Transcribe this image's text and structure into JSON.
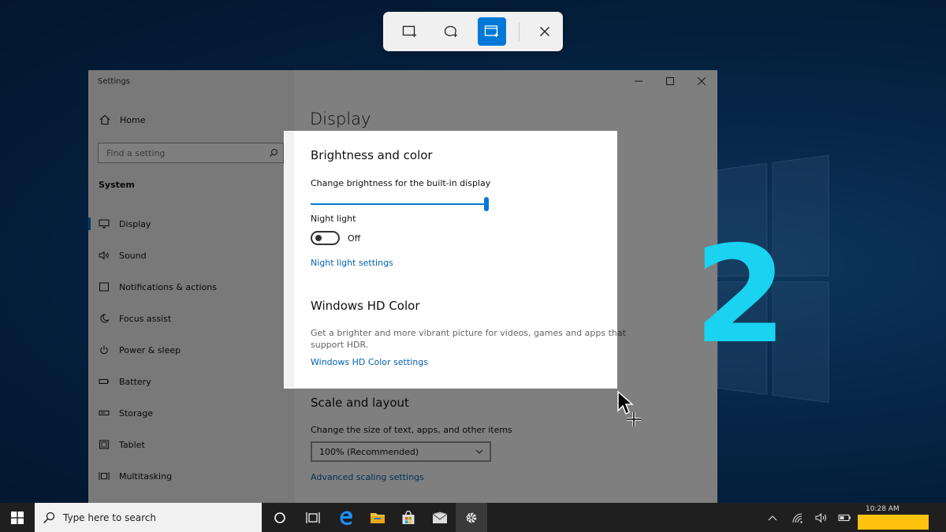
{
  "snip_toolbar": {
    "modes": [
      "rectangular-snip",
      "freeform-snip",
      "window-snip"
    ],
    "active_mode": "window-snip",
    "close": "close"
  },
  "settings": {
    "window_title": "Settings",
    "home_label": "Home",
    "search_placeholder": "Find a setting",
    "section": "System",
    "nav": [
      {
        "label": "Display",
        "icon": "monitor-icon"
      },
      {
        "label": "Sound",
        "icon": "speaker-icon"
      },
      {
        "label": "Notifications & actions",
        "icon": "notification-icon"
      },
      {
        "label": "Focus assist",
        "icon": "moon-icon"
      },
      {
        "label": "Power & sleep",
        "icon": "power-icon"
      },
      {
        "label": "Battery",
        "icon": "battery-icon"
      },
      {
        "label": "Storage",
        "icon": "storage-icon"
      },
      {
        "label": "Tablet",
        "icon": "tablet-icon"
      },
      {
        "label": "Multitasking",
        "icon": "multitasking-icon"
      }
    ],
    "active_nav": "Display",
    "content": {
      "page_title": "Display",
      "brightness_heading": "Brightness and color",
      "brightness_label": "Change brightness for the built-in display",
      "brightness_value": 100,
      "night_light_label": "Night light",
      "night_light_state": "Off",
      "night_light_link": "Night light settings",
      "hd_heading": "Windows HD Color",
      "hd_desc_line1": "Get a brighter and more vibrant picture for videos, games and apps that",
      "hd_desc_line2": "support HDR.",
      "hd_link": "Windows HD Color settings",
      "scale_heading": "Scale and layout",
      "scale_label": "Change the size of text, apps, and other items",
      "scale_value": "100% (Recommended)",
      "advanced_link": "Advanced scaling settings"
    }
  },
  "overlay_number": "2",
  "taskbar": {
    "search_placeholder": "Type here to search",
    "clock_time": "10:28 AM"
  },
  "colors": {
    "accent": "#0078d7",
    "link": "#0063b1",
    "overlay_number": "#19d3f0",
    "redaction": "#ffc20e"
  }
}
